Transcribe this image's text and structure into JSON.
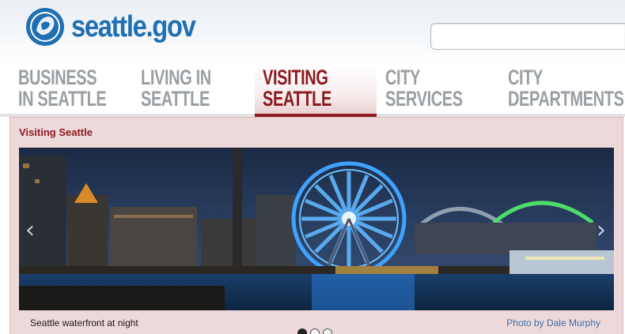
{
  "site": {
    "logo_text": "seattle.gov"
  },
  "search": {
    "value": "",
    "placeholder": ""
  },
  "nav": {
    "items": [
      {
        "line1": "BUSINESS",
        "line2": "IN SEATTLE",
        "active": false
      },
      {
        "line1": "LIVING IN",
        "line2": "SEATTLE",
        "active": false
      },
      {
        "line1": "VISITING",
        "line2": "SEATTLE",
        "active": true
      },
      {
        "line1": "CITY",
        "line2": "SERVICES",
        "active": false
      },
      {
        "line1": "CITY",
        "line2": "DEPARTMENTS",
        "active": false
      }
    ]
  },
  "panel": {
    "title": "Visiting Seattle",
    "caption": "Seattle waterfront at night",
    "credit": "Photo by Dale Murphy",
    "slide_count": 3,
    "active_slide": 1
  },
  "icons": {
    "prev": "chevron-left-icon",
    "next": "chevron-right-icon",
    "logo": "city-seal-icon"
  },
  "colors": {
    "brand_blue": "#1f6fb2",
    "active_nav": "#8b1a1f",
    "inactive_nav": "#9a9fa4",
    "panel_bg": "#eed9da",
    "credit_link": "#3a6fa8"
  }
}
